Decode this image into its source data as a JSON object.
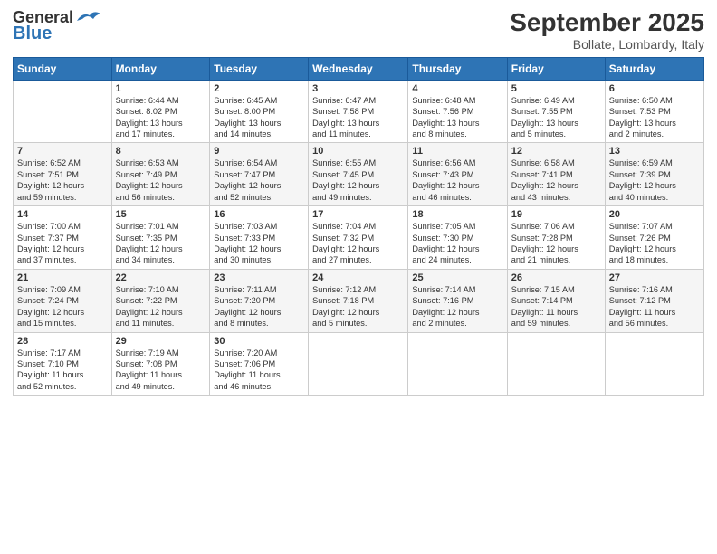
{
  "header": {
    "logo_line1": "General",
    "logo_line2": "Blue",
    "month_title": "September 2025",
    "subtitle": "Bollate, Lombardy, Italy"
  },
  "weekdays": [
    "Sunday",
    "Monday",
    "Tuesday",
    "Wednesday",
    "Thursday",
    "Friday",
    "Saturday"
  ],
  "weeks": [
    [
      {
        "day": "",
        "info": ""
      },
      {
        "day": "1",
        "info": "Sunrise: 6:44 AM\nSunset: 8:02 PM\nDaylight: 13 hours\nand 17 minutes."
      },
      {
        "day": "2",
        "info": "Sunrise: 6:45 AM\nSunset: 8:00 PM\nDaylight: 13 hours\nand 14 minutes."
      },
      {
        "day": "3",
        "info": "Sunrise: 6:47 AM\nSunset: 7:58 PM\nDaylight: 13 hours\nand 11 minutes."
      },
      {
        "day": "4",
        "info": "Sunrise: 6:48 AM\nSunset: 7:56 PM\nDaylight: 13 hours\nand 8 minutes."
      },
      {
        "day": "5",
        "info": "Sunrise: 6:49 AM\nSunset: 7:55 PM\nDaylight: 13 hours\nand 5 minutes."
      },
      {
        "day": "6",
        "info": "Sunrise: 6:50 AM\nSunset: 7:53 PM\nDaylight: 13 hours\nand 2 minutes."
      }
    ],
    [
      {
        "day": "7",
        "info": "Sunrise: 6:52 AM\nSunset: 7:51 PM\nDaylight: 12 hours\nand 59 minutes."
      },
      {
        "day": "8",
        "info": "Sunrise: 6:53 AM\nSunset: 7:49 PM\nDaylight: 12 hours\nand 56 minutes."
      },
      {
        "day": "9",
        "info": "Sunrise: 6:54 AM\nSunset: 7:47 PM\nDaylight: 12 hours\nand 52 minutes."
      },
      {
        "day": "10",
        "info": "Sunrise: 6:55 AM\nSunset: 7:45 PM\nDaylight: 12 hours\nand 49 minutes."
      },
      {
        "day": "11",
        "info": "Sunrise: 6:56 AM\nSunset: 7:43 PM\nDaylight: 12 hours\nand 46 minutes."
      },
      {
        "day": "12",
        "info": "Sunrise: 6:58 AM\nSunset: 7:41 PM\nDaylight: 12 hours\nand 43 minutes."
      },
      {
        "day": "13",
        "info": "Sunrise: 6:59 AM\nSunset: 7:39 PM\nDaylight: 12 hours\nand 40 minutes."
      }
    ],
    [
      {
        "day": "14",
        "info": "Sunrise: 7:00 AM\nSunset: 7:37 PM\nDaylight: 12 hours\nand 37 minutes."
      },
      {
        "day": "15",
        "info": "Sunrise: 7:01 AM\nSunset: 7:35 PM\nDaylight: 12 hours\nand 34 minutes."
      },
      {
        "day": "16",
        "info": "Sunrise: 7:03 AM\nSunset: 7:33 PM\nDaylight: 12 hours\nand 30 minutes."
      },
      {
        "day": "17",
        "info": "Sunrise: 7:04 AM\nSunset: 7:32 PM\nDaylight: 12 hours\nand 27 minutes."
      },
      {
        "day": "18",
        "info": "Sunrise: 7:05 AM\nSunset: 7:30 PM\nDaylight: 12 hours\nand 24 minutes."
      },
      {
        "day": "19",
        "info": "Sunrise: 7:06 AM\nSunset: 7:28 PM\nDaylight: 12 hours\nand 21 minutes."
      },
      {
        "day": "20",
        "info": "Sunrise: 7:07 AM\nSunset: 7:26 PM\nDaylight: 12 hours\nand 18 minutes."
      }
    ],
    [
      {
        "day": "21",
        "info": "Sunrise: 7:09 AM\nSunset: 7:24 PM\nDaylight: 12 hours\nand 15 minutes."
      },
      {
        "day": "22",
        "info": "Sunrise: 7:10 AM\nSunset: 7:22 PM\nDaylight: 12 hours\nand 11 minutes."
      },
      {
        "day": "23",
        "info": "Sunrise: 7:11 AM\nSunset: 7:20 PM\nDaylight: 12 hours\nand 8 minutes."
      },
      {
        "day": "24",
        "info": "Sunrise: 7:12 AM\nSunset: 7:18 PM\nDaylight: 12 hours\nand 5 minutes."
      },
      {
        "day": "25",
        "info": "Sunrise: 7:14 AM\nSunset: 7:16 PM\nDaylight: 12 hours\nand 2 minutes."
      },
      {
        "day": "26",
        "info": "Sunrise: 7:15 AM\nSunset: 7:14 PM\nDaylight: 11 hours\nand 59 minutes."
      },
      {
        "day": "27",
        "info": "Sunrise: 7:16 AM\nSunset: 7:12 PM\nDaylight: 11 hours\nand 56 minutes."
      }
    ],
    [
      {
        "day": "28",
        "info": "Sunrise: 7:17 AM\nSunset: 7:10 PM\nDaylight: 11 hours\nand 52 minutes."
      },
      {
        "day": "29",
        "info": "Sunrise: 7:19 AM\nSunset: 7:08 PM\nDaylight: 11 hours\nand 49 minutes."
      },
      {
        "day": "30",
        "info": "Sunrise: 7:20 AM\nSunset: 7:06 PM\nDaylight: 11 hours\nand 46 minutes."
      },
      {
        "day": "",
        "info": ""
      },
      {
        "day": "",
        "info": ""
      },
      {
        "day": "",
        "info": ""
      },
      {
        "day": "",
        "info": ""
      }
    ]
  ]
}
